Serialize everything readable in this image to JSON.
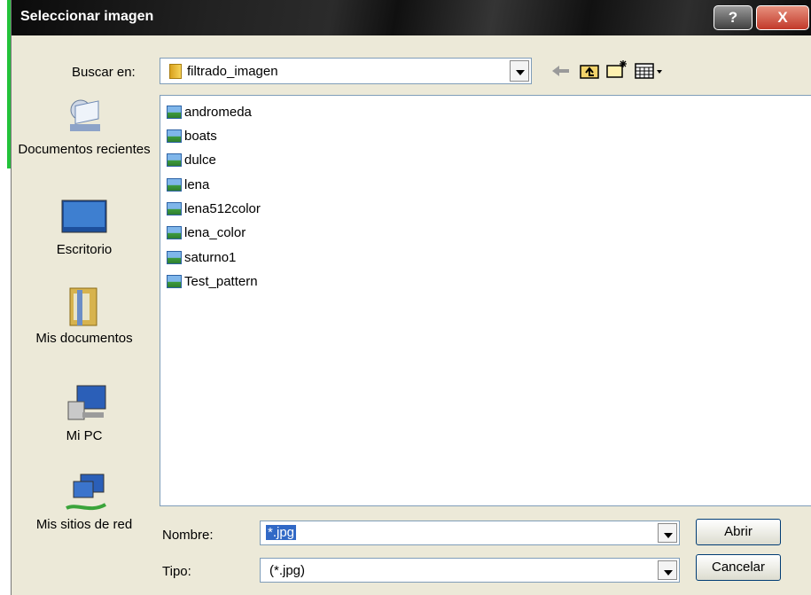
{
  "window": {
    "title": "Seleccionar imagen",
    "help_label": "?",
    "close_label": "X"
  },
  "lookin": {
    "label": "Buscar en:",
    "folder": "filtrado_imagen"
  },
  "places": [
    {
      "label": "Documentos recientes",
      "icon": "recent-documents-icon"
    },
    {
      "label": "Escritorio",
      "icon": "desktop-icon"
    },
    {
      "label": "Mis documentos",
      "icon": "my-documents-icon"
    },
    {
      "label": "Mi PC",
      "icon": "my-computer-icon"
    },
    {
      "label": "Mis sitios de red",
      "icon": "network-places-icon"
    }
  ],
  "files": [
    "andromeda",
    "boats",
    "dulce",
    "lena",
    "lena512color",
    "lena_color",
    "saturno1",
    "Test_pattern"
  ],
  "filename": {
    "label": "Nombre:",
    "value": "*.jpg"
  },
  "filetype": {
    "label": "Tipo:",
    "value": "(*.jpg)"
  },
  "buttons": {
    "open": "Abrir",
    "cancel": "Cancelar"
  },
  "colors": {
    "accent": "#23c23a",
    "selection": "#3169c6",
    "dialog_bg": "#ece9d8"
  }
}
